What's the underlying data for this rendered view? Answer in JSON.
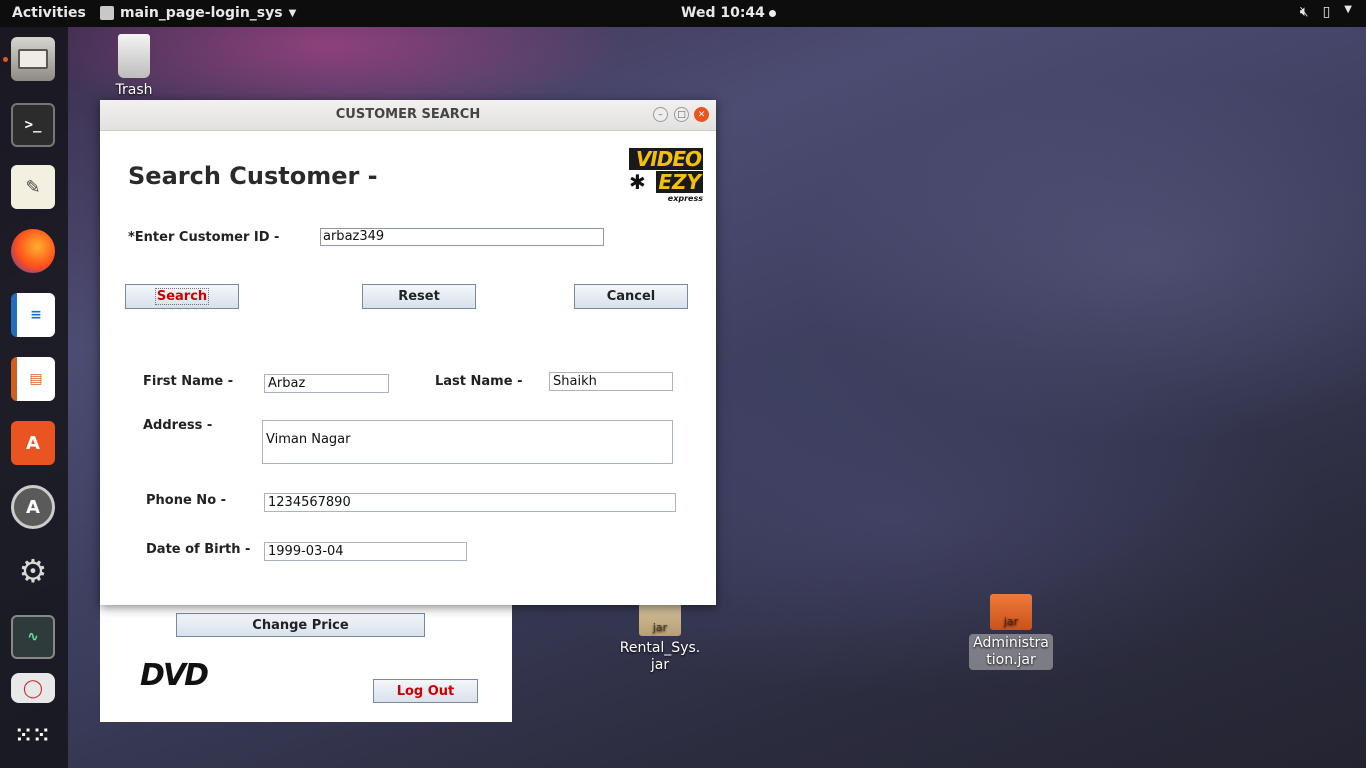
{
  "topbar": {
    "activities": "Activities",
    "app_name": "main_page-login_sys",
    "clock": "Wed 10:44"
  },
  "desktop": {
    "trash_label": "Trash",
    "rental_jar_label": "Rental_Sys.\njar",
    "admin_jar_label": "Administra\ntion.jar",
    "jar_tag": "jar"
  },
  "background_window": {
    "change_price_label": "Change Price",
    "logout_label": "Log Out",
    "dvd_logo": "DVD"
  },
  "dialog": {
    "title": "CUSTOMER SEARCH",
    "heading": "Search Customer  -",
    "logo": {
      "line1": "VIDEO",
      "line2": "EZY",
      "line3": "express"
    },
    "customer_id_label": "*Enter Customer ID -",
    "customer_id_value": "arbaz349",
    "search_label": "Search",
    "reset_label": "Reset",
    "cancel_label": "Cancel",
    "first_name_label": "First Name -",
    "first_name_value": "Arbaz",
    "last_name_label": "Last Name -",
    "last_name_value": "Shaikh",
    "address_label": "Address -",
    "address_value": "Viman Nagar",
    "phone_label": "Phone No -",
    "phone_value": "1234567890",
    "dob_label": "Date of Birth -",
    "dob_value": "1999-03-04"
  },
  "colors": {
    "accent": "#e95420",
    "search_text": "#d00000",
    "logout_text": "#d00000",
    "field_border": "#a8b4c4"
  }
}
